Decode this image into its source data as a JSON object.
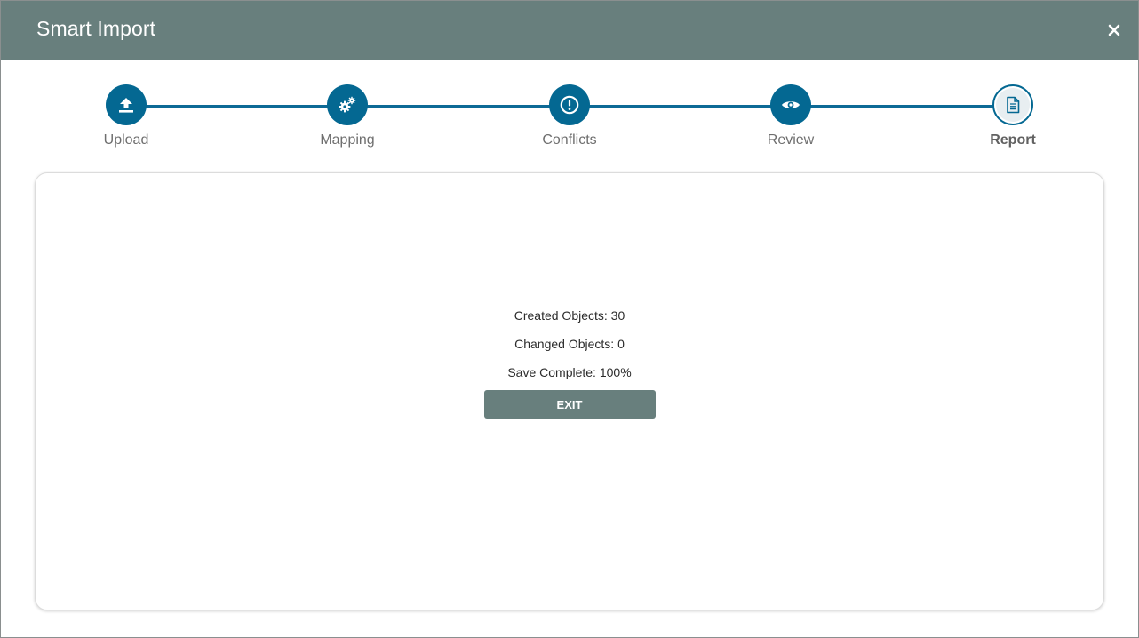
{
  "dialog": {
    "title": "Smart Import",
    "close_icon": "close-icon"
  },
  "stepper": {
    "steps": [
      {
        "label": "Upload",
        "icon": "upload-icon",
        "state": "done"
      },
      {
        "label": "Mapping",
        "icon": "gears-icon",
        "state": "done"
      },
      {
        "label": "Conflicts",
        "icon": "exclamation-circle-icon",
        "state": "done"
      },
      {
        "label": "Review",
        "icon": "eye-icon",
        "state": "done"
      },
      {
        "label": "Report",
        "icon": "document-icon",
        "state": "current"
      }
    ],
    "accent_color": "#046892"
  },
  "report": {
    "created": "Created Objects: 30",
    "changed": "Changed Objects: 0",
    "save_complete": "Save Complete: 100%",
    "exit_label": "EXIT"
  },
  "colors": {
    "header": "#687f7d",
    "accent": "#046892"
  }
}
